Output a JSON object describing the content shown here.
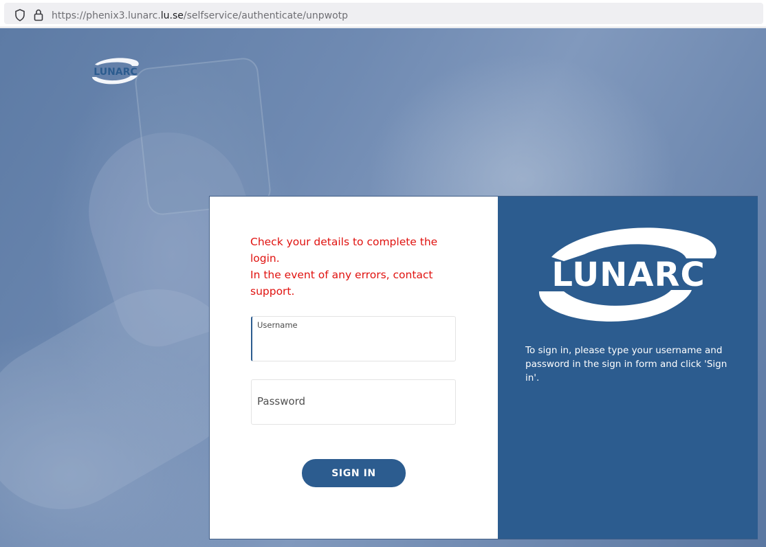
{
  "browser": {
    "url_prefix": "https://phenix3.lunarc.",
    "url_domain": "lu.se",
    "url_path": "/selfservice/authenticate/unpwotp",
    "icons": {
      "shield": "shield-icon",
      "lock": "lock-icon"
    }
  },
  "branding": {
    "logo_text": "LUNARC",
    "colors": {
      "primary": "#2c5c8f",
      "error": "#e0120f"
    }
  },
  "login": {
    "error_line1": "Check your details to complete the login.",
    "error_line2": "In the event of any errors, contact support.",
    "username_label": "Username",
    "username_value": "",
    "password_placeholder": "Password",
    "password_value": "",
    "signin_label": "SIGN IN"
  },
  "info": {
    "text": "To sign in, please type your username and password in the sign in form and click 'Sign in'."
  }
}
